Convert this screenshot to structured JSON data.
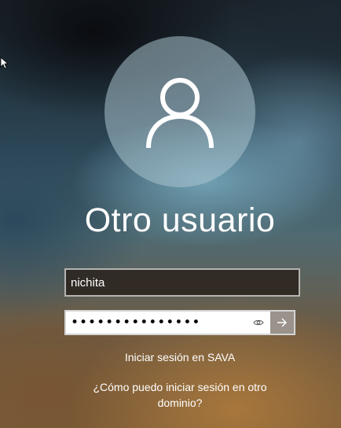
{
  "login": {
    "user_title": "Otro usuario",
    "username_value": "nichita",
    "password_value": "•••••••••••••••",
    "sign_in_link": "Iniciar sesión en SAVA",
    "help_link": "¿Cómo puedo iniciar sesión en otro dominio?"
  },
  "icons": {
    "avatar": "user-silhouette-icon",
    "reveal": "eye-icon",
    "submit": "arrow-right-icon",
    "cursor": "mouse-pointer-icon"
  },
  "colors": {
    "text": "#ffffff",
    "avatar_bg": "#aac3cd",
    "field_border": "#cdcdcd"
  }
}
